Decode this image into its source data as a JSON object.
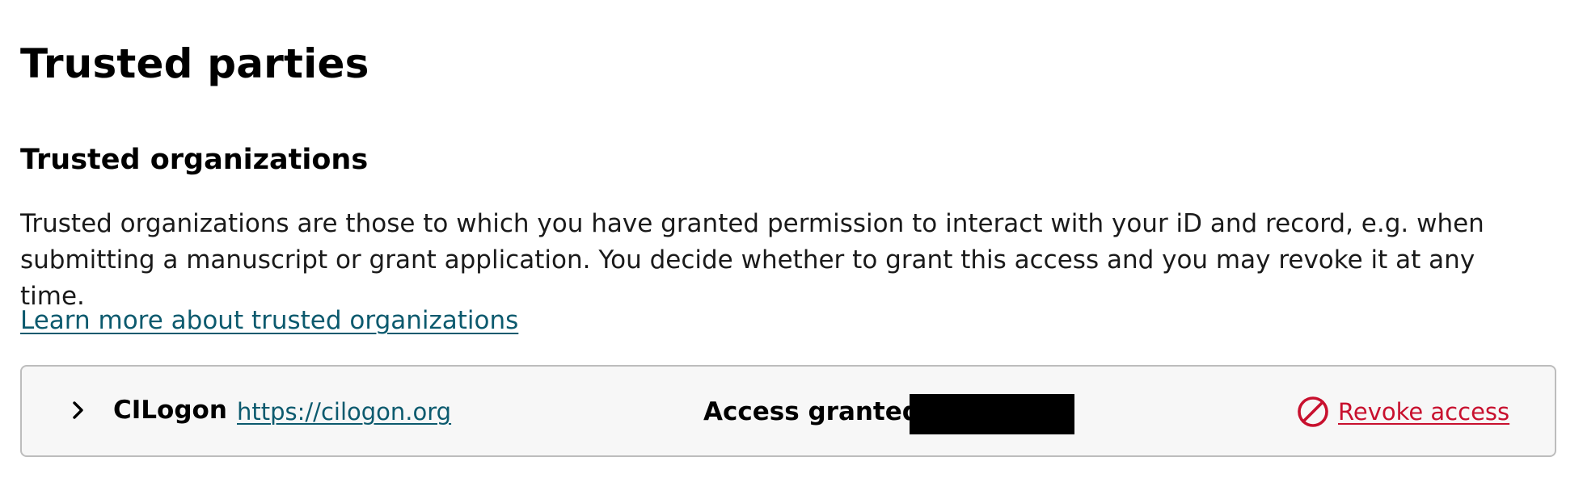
{
  "page": {
    "title": "Trusted parties"
  },
  "section": {
    "title": "Trusted organizations",
    "description": "Trusted organizations are those to which you have granted permission to interact with your iD and record, e.g. when submitting a manuscript or grant application. You decide whether to grant this access and you may revoke it at any time.",
    "learn_more_link": "Learn more about trusted organizations"
  },
  "organizations": [
    {
      "name": "CILogon",
      "url": "https://cilogon.org",
      "access_granted_label": "Access granted:",
      "access_granted_value": "[redacted]",
      "revoke_label": "Revoke access",
      "expand_icon": "chevron-right-icon",
      "revoke_icon": "block-icon"
    }
  ],
  "colors": {
    "link": "#0c5a6e",
    "revoke": "#c8102e",
    "row_background": "#f7f7f7",
    "row_border": "#bdbdbd"
  }
}
